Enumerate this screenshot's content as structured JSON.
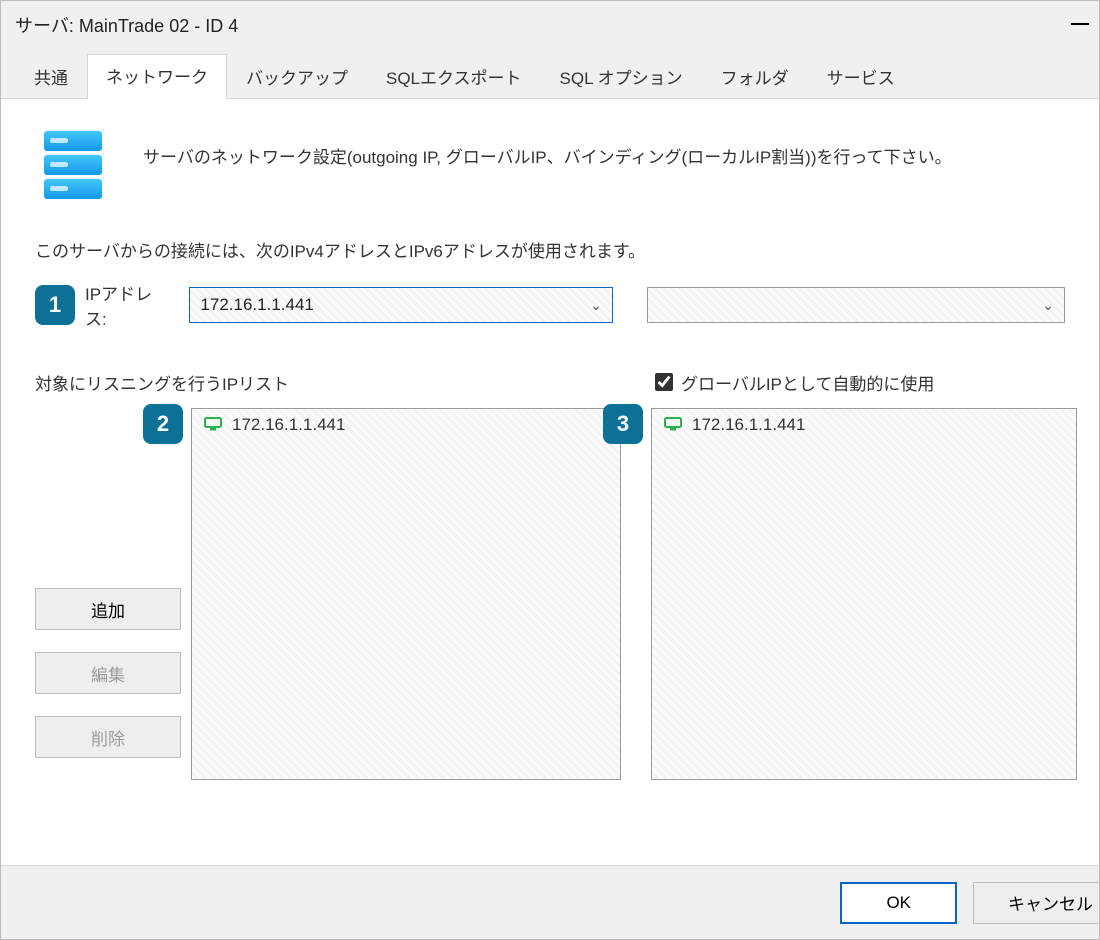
{
  "title": "サーバ: MainTrade 02 - ID  4",
  "tabs": [
    {
      "label": "共通",
      "active": false
    },
    {
      "label": "ネットワーク",
      "active": true
    },
    {
      "label": "バックアップ",
      "active": false
    },
    {
      "label": "SQLエクスポート",
      "active": false
    },
    {
      "label": "SQL オプション",
      "active": false
    },
    {
      "label": "フォルダ",
      "active": false
    },
    {
      "label": "サービス",
      "active": false
    }
  ],
  "intro": "サーバのネットワーク設定(outgoing IP, グローバルIP、バインディング(ローカルIP割当))を行って下さい。",
  "desc": "このサーバからの接続には、次のIPv4アドレスとIPv6アドレスが使用されます。",
  "badges": {
    "1": "1",
    "2": "2",
    "3": "3"
  },
  "ip_label": "IPアドレス:",
  "ip_combo1_value": "172.16.1.1.441",
  "ip_combo2_value": "",
  "left_header": "対象にリスニングを行うIPリスト",
  "right_checkbox_label": "グローバルIPとして自動的に使用",
  "right_checked": true,
  "left_list": [
    {
      "ip": "172.16.1.1.441"
    }
  ],
  "right_list": [
    {
      "ip": "172.16.1.1.441"
    }
  ],
  "buttons": {
    "add": "追加",
    "edit": "編集",
    "delete": "削除",
    "ok": "OK",
    "cancel": "キャンセル"
  }
}
